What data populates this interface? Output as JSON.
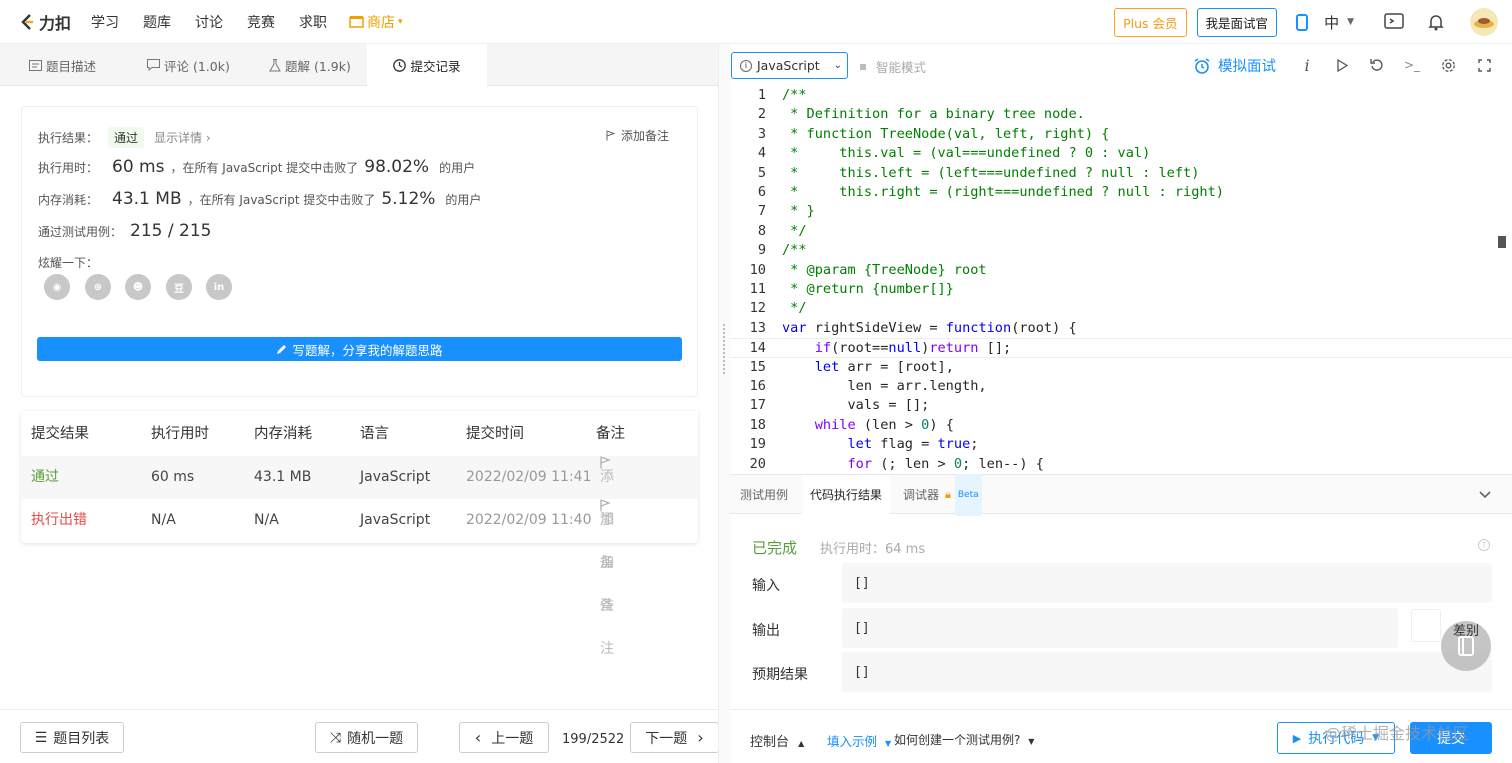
{
  "nav": {
    "logo_text": "力扣",
    "links": [
      "学习",
      "题库",
      "讨论",
      "竞赛",
      "求职"
    ],
    "shop": "商店",
    "plus": "Plus 会员",
    "interviewer": "我是面试官",
    "lang": "中"
  },
  "left_tabs": [
    {
      "label": "题目描述",
      "icon": "document-icon"
    },
    {
      "label": "评论 (1.0k)",
      "icon": "comment-icon"
    },
    {
      "label": "题解 (1.9k)",
      "icon": "flask-icon"
    },
    {
      "label": "提交记录",
      "icon": "clock-icon"
    }
  ],
  "result": {
    "label_result": "执行结果：",
    "status": "通过",
    "show_details": "显示详情",
    "add_note": "添加备注",
    "label_time": "执行用时：",
    "time_value": "60 ms",
    "time_text": "，在所有 JavaScript 提交中击败了",
    "time_pct": "98.02%",
    "users": "的用户",
    "label_mem": "内存消耗：",
    "mem_value": "43.1 MB",
    "mem_text": "，在所有 JavaScript 提交中击败了",
    "mem_pct": "5.12%",
    "label_cases": "通过测试用例：",
    "cases_value": "215 / 215",
    "share_label": "炫耀一下：",
    "social_icons": [
      "wechat-icon",
      "weibo-icon",
      "qq-icon",
      "douban-icon",
      "linkedin-icon"
    ],
    "write_solution": "写题解，分享我的解题思路"
  },
  "submissions": {
    "headers": [
      "提交结果",
      "执行用时",
      "内存消耗",
      "语言",
      "提交时间",
      "备注"
    ],
    "rows": [
      {
        "result": "通过",
        "time": "60 ms",
        "memory": "43.1 MB",
        "lang": "JavaScript",
        "submitted": "2022/02/09 11:41",
        "note": "添加备注",
        "color": "#5a9e3b"
      },
      {
        "result": "执行出错",
        "time": "N/A",
        "memory": "N/A",
        "lang": "JavaScript",
        "submitted": "2022/02/09 11:40",
        "note": "添加备注",
        "color": "#e34a4a"
      }
    ]
  },
  "bottom_left": {
    "problem_list": "题目列表",
    "random": "随机一题",
    "prev": "上一题",
    "page": "199/2522",
    "next": "下一题"
  },
  "editor": {
    "language": "JavaScript",
    "smart_mode": "智能模式",
    "mock_interview": "模拟面试",
    "current_line": 14
  },
  "code_lines": [
    [
      [
        "c",
        "/**"
      ]
    ],
    [
      [
        "c",
        " * Definition for a binary tree node."
      ]
    ],
    [
      [
        "c",
        " * function TreeNode(val, left, right) {"
      ]
    ],
    [
      [
        "c",
        " *     this.val = (val===undefined ? 0 : val)"
      ]
    ],
    [
      [
        "c",
        " *     this.left = (left===undefined ? null : left)"
      ]
    ],
    [
      [
        "c",
        " *     this.right = (right===undefined ? null : right)"
      ]
    ],
    [
      [
        "c",
        " * }"
      ]
    ],
    [
      [
        "c",
        " */"
      ]
    ],
    [
      [
        "c",
        "/**"
      ]
    ],
    [
      [
        "c",
        " * @param {TreeNode} root"
      ]
    ],
    [
      [
        "c",
        " * @return {number[]}"
      ]
    ],
    [
      [
        "c",
        " */"
      ]
    ],
    [
      [
        "kw",
        "var"
      ],
      [
        "p",
        " rightSideView = "
      ],
      [
        "kw",
        "function"
      ],
      [
        "p",
        "(root) {"
      ]
    ],
    [
      [
        "p",
        "    "
      ],
      [
        "k",
        "if"
      ],
      [
        "p",
        "(root=="
      ],
      [
        "kw",
        "null"
      ],
      [
        "p",
        ")"
      ],
      [
        "k",
        "return"
      ],
      [
        "p",
        " [];"
      ]
    ],
    [
      [
        "p",
        "    "
      ],
      [
        "kw",
        "let"
      ],
      [
        "p",
        " arr = [root],"
      ]
    ],
    [
      [
        "p",
        "        len = arr.length,"
      ]
    ],
    [
      [
        "p",
        "        vals = [];"
      ]
    ],
    [
      [
        "p",
        "    "
      ],
      [
        "k",
        "while"
      ],
      [
        "p",
        " (len > "
      ],
      [
        "n",
        "0"
      ],
      [
        "p",
        ") {"
      ]
    ],
    [
      [
        "p",
        "        "
      ],
      [
        "kw",
        "let"
      ],
      [
        "p",
        " flag = "
      ],
      [
        "kw",
        "true"
      ],
      [
        "p",
        ";"
      ]
    ],
    [
      [
        "p",
        "        "
      ],
      [
        "k",
        "for"
      ],
      [
        "p",
        " (; len > "
      ],
      [
        "n",
        "0"
      ],
      [
        "p",
        "; len--) {"
      ]
    ]
  ],
  "console": {
    "tabs": [
      "测试用例",
      "代码执行结果",
      "调试器"
    ],
    "beta": "Beta",
    "status": "已完成",
    "exec_time": "执行用时：64 ms",
    "input_label": "输入",
    "input_value": "[]",
    "output_label": "输出",
    "output_value": "[]",
    "expected_label": "预期结果",
    "expected_value": "[]",
    "diff": "差别"
  },
  "bottom_right": {
    "console": "控制台",
    "fill_example": "填入示例",
    "howto": "如何创建一个测试用例?",
    "run": "执行代码",
    "submit": "提交"
  },
  "watermark": "@稀土掘金技术社区"
}
